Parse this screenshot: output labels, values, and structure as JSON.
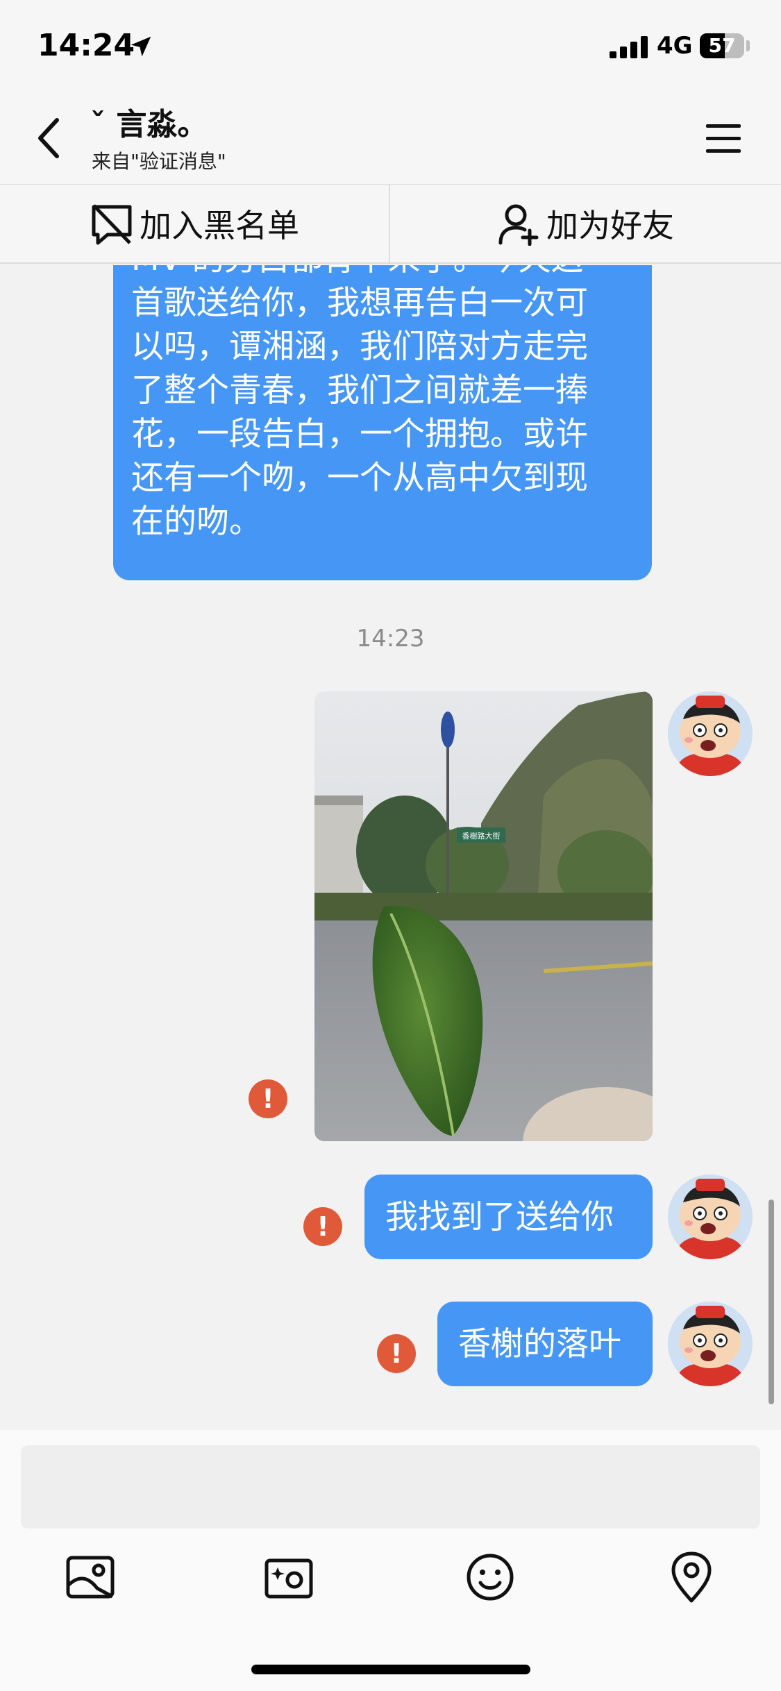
{
  "status_bar": {
    "time": "14:24",
    "network": "4G",
    "battery_level": 57,
    "battery_text": "57"
  },
  "header": {
    "contact_name": "ˇ 言淼。",
    "contact_source": "来自\"验证消息\""
  },
  "actions": {
    "blacklist_label": "加入黑名单",
    "add_friend_label": "加为好友"
  },
  "messages": {
    "long_message_lines": [
      "MV 的旁白都背下来了。今天这",
      "首歌送给你，我想再告白一次可",
      "以吗，谭湘涵，我们陪对方走完",
      "了整个青春，我们之间就差一捧",
      "花，一段告白，一个拥抱。或许",
      "还有一个吻，一个从高中欠到现",
      "在的吻。"
    ],
    "timestamp": "14:23",
    "image_sign_text": "香樹路大街",
    "msg_found_it": "我找到了送给你",
    "msg_fallen_leaf": "香榭的落叶",
    "error_mark": "!"
  },
  "colors": {
    "bubble": "#4697f5",
    "error": "#e05a3a",
    "background": "#f2f2f2"
  },
  "icons": {
    "back": "chevron-left-icon",
    "menu": "hamburger-menu-icon",
    "blacklist": "block-chat-icon",
    "add_friend": "add-user-icon",
    "album": "photo-album-icon",
    "camera": "camera-icon",
    "emoji": "emoji-icon",
    "location": "location-pin-icon"
  }
}
